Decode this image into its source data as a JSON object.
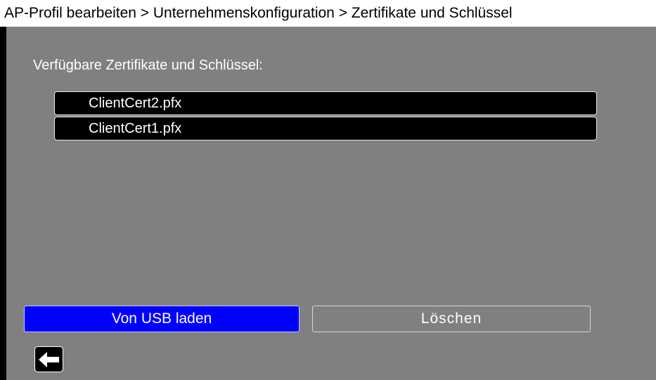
{
  "header": {
    "breadcrumb": "AP-Profil bearbeiten > Unternehmenskonfiguration > Zertifikate und Schlüssel"
  },
  "certificates": {
    "label": "Verfügbare Zertifikate und Schlüssel:",
    "items": [
      "ClientCert2.pfx",
      "ClientCert1.pfx"
    ]
  },
  "actions": {
    "load_usb_label": "Von USB laden",
    "delete_label": "Löschen"
  },
  "navigation": {
    "back_icon": "arrow-left-icon"
  },
  "colors": {
    "panel_background": "#808080",
    "primary_button": "#0000ff",
    "header_background": "#ffffff"
  }
}
